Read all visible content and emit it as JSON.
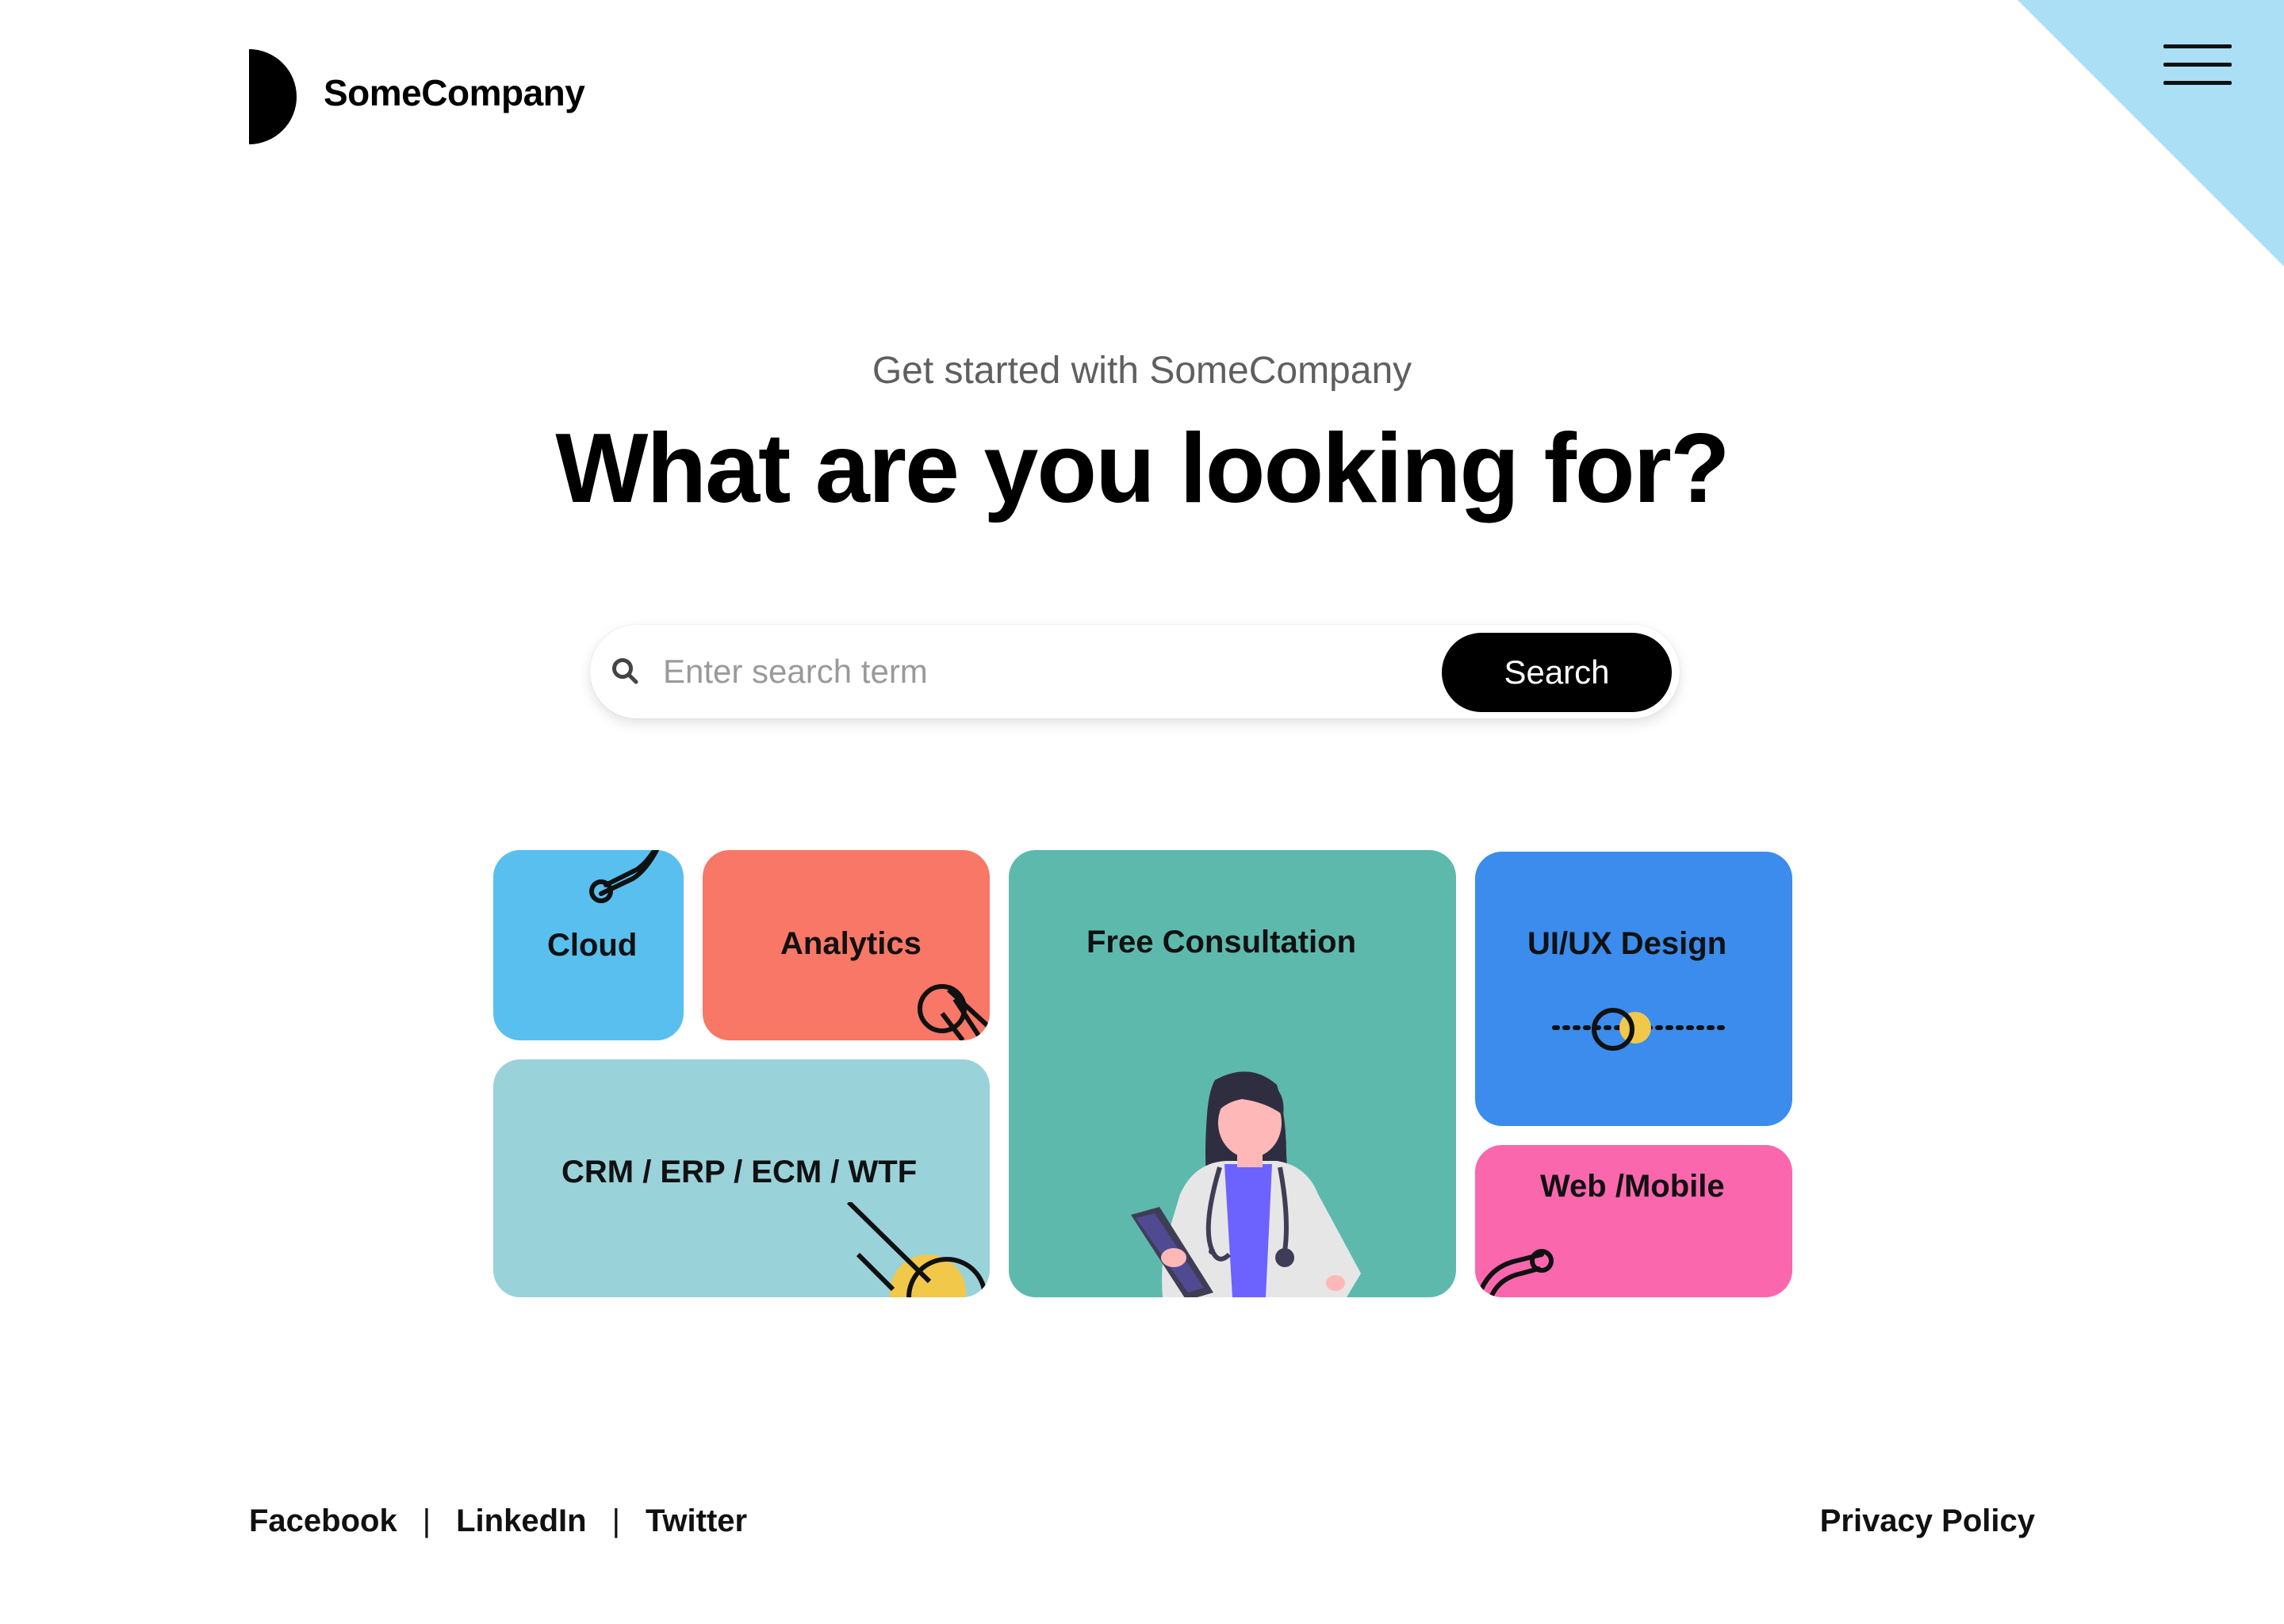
{
  "brand": {
    "name": "SomeCompany"
  },
  "header": {
    "menu_icon": "hamburger-menu-icon",
    "corner_color": "#aadff5"
  },
  "hero": {
    "subtitle": "Get started with SomeCompany",
    "title": "What are you looking for?"
  },
  "search": {
    "placeholder": "Enter search term",
    "value": "",
    "button_label": "Search",
    "icon": "search-icon"
  },
  "tiles": {
    "cloud": {
      "label": "Cloud",
      "color": "#59bfee"
    },
    "analytics": {
      "label": "Analytics",
      "color": "#f87766"
    },
    "crm": {
      "label": "CRM / ERP / ECM / WTF",
      "color": "#9ad2da"
    },
    "consultation": {
      "label": "Free Consultation",
      "color": "#5eb9ad"
    },
    "uiux": {
      "label": "UI/UX Design",
      "color": "#3b8cec"
    },
    "web": {
      "label": "Web /Mobile",
      "color": "#fb67ad"
    }
  },
  "footer": {
    "social": [
      "Facebook",
      "LinkedIn",
      "Twitter"
    ],
    "separator": "|",
    "privacy": "Privacy Policy"
  }
}
